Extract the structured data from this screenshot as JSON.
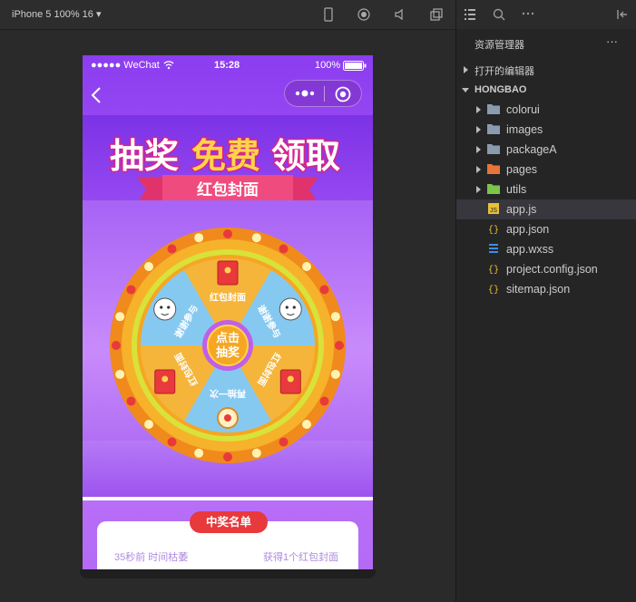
{
  "toolbar": {
    "device_label": "iPhone 5 100% 16 ▾"
  },
  "phone": {
    "status": {
      "carrier": "●●●●● WeChat",
      "time": "15:28",
      "battery": "100%"
    },
    "banner": {
      "title_part1": "抽奖",
      "title_part2": "免费",
      "title_part3": "领取",
      "ribbon": "红包封面"
    },
    "wheel": {
      "center_line1": "点击",
      "center_line2": "抽奖",
      "prizes": [
        "红包封面",
        "谢谢参与",
        "红包封面",
        "再抽一次",
        "红包封面",
        "谢谢参与"
      ]
    },
    "winners": {
      "badge": "中奖名单",
      "rows": [
        {
          "who": "35秒前 时间枯萎",
          "what": "获得1个红包封面"
        }
      ]
    }
  },
  "explorer": {
    "title": "资源管理器",
    "more": "···",
    "open_editors": "打开的编辑器",
    "project": "HONGBAO",
    "items": [
      {
        "name": "colorui",
        "type": "folder"
      },
      {
        "name": "images",
        "type": "folder"
      },
      {
        "name": "packageA",
        "type": "folder"
      },
      {
        "name": "pages",
        "type": "folder"
      },
      {
        "name": "utils",
        "type": "folder"
      },
      {
        "name": "app.js",
        "type": "js"
      },
      {
        "name": "app.json",
        "type": "json"
      },
      {
        "name": "app.wxss",
        "type": "wxss"
      },
      {
        "name": "project.config.json",
        "type": "json"
      },
      {
        "name": "sitemap.json",
        "type": "json"
      }
    ]
  },
  "colors": {
    "accent_red": "#e8393c",
    "wheel_orange": "#f5a623",
    "purple": "#9b4cf2"
  }
}
